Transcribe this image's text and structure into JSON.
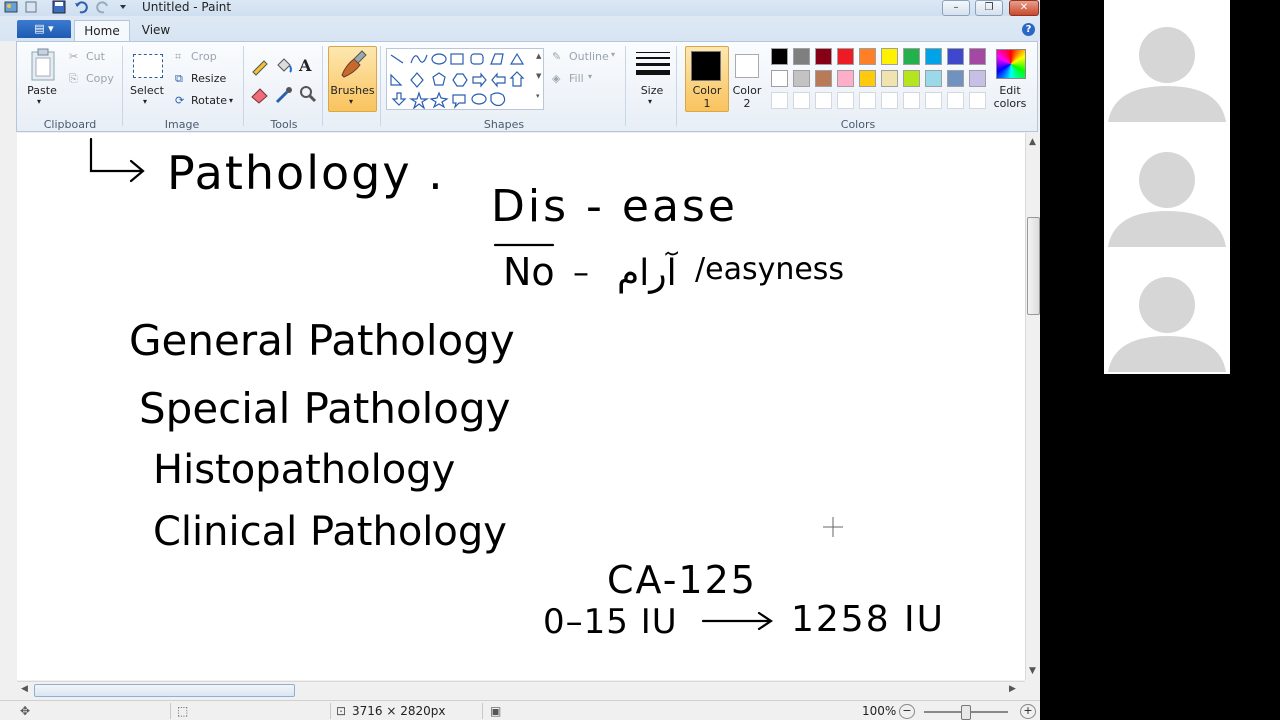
{
  "window": {
    "title": "Untitled - Paint",
    "minimize": "–",
    "maximize": "❐",
    "close": "✕"
  },
  "menu": {
    "file_button": "▤ ▾",
    "tabs": [
      {
        "label": "Home",
        "active": true
      },
      {
        "label": "View",
        "active": false
      }
    ],
    "help": "?"
  },
  "ribbon": {
    "clipboard": {
      "paste": "Paste",
      "cut": "Cut",
      "copy": "Copy",
      "group": "Clipboard"
    },
    "image": {
      "select": "Select",
      "crop": "Crop",
      "resize": "Resize",
      "rotate": "Rotate",
      "group": "Image"
    },
    "tools": {
      "group": "Tools"
    },
    "brushes": {
      "label": "Brushes"
    },
    "shapes": {
      "outline": "Outline",
      "fill": "Fill",
      "group": "Shapes"
    },
    "size": {
      "label": "Size"
    },
    "colors": {
      "color1_label": "Color",
      "color1_num": "1",
      "color2_label": "Color",
      "color2_num": "2",
      "color1_value": "#000000",
      "color2_value": "#ffffff",
      "edit_label_1": "Edit",
      "edit_label_2": "colors",
      "group": "Colors",
      "palette_row1": [
        "#000000",
        "#7f7f7f",
        "#880015",
        "#ed1c24",
        "#ff7f27",
        "#fff200",
        "#22b14c",
        "#00a2e8",
        "#3f48cc",
        "#a349a4"
      ],
      "palette_row2": [
        "#ffffff",
        "#c3c3c3",
        "#b97a57",
        "#ffaec9",
        "#ffc90e",
        "#efe4b0",
        "#b5e61d",
        "#99d9ea",
        "#7092be",
        "#c8bfe7"
      ]
    }
  },
  "canvas": {
    "notes": {
      "pathology": "Pathology .",
      "disease": "Dis - ease",
      "no": "No",
      "dash": "–",
      "urdu": "آرام",
      "easyness": "/easyness",
      "general": "General Pathology",
      "special": "Special Pathology",
      "histo": "Histopathology",
      "clinical": "Clinical Pathology",
      "ca125": "CA-125",
      "range": "0–15 IU",
      "value": "1258 IU"
    }
  },
  "status": {
    "dimensions": "3716 × 2820px",
    "zoom": "100%",
    "zoom_minus": "−",
    "zoom_plus": "+"
  }
}
